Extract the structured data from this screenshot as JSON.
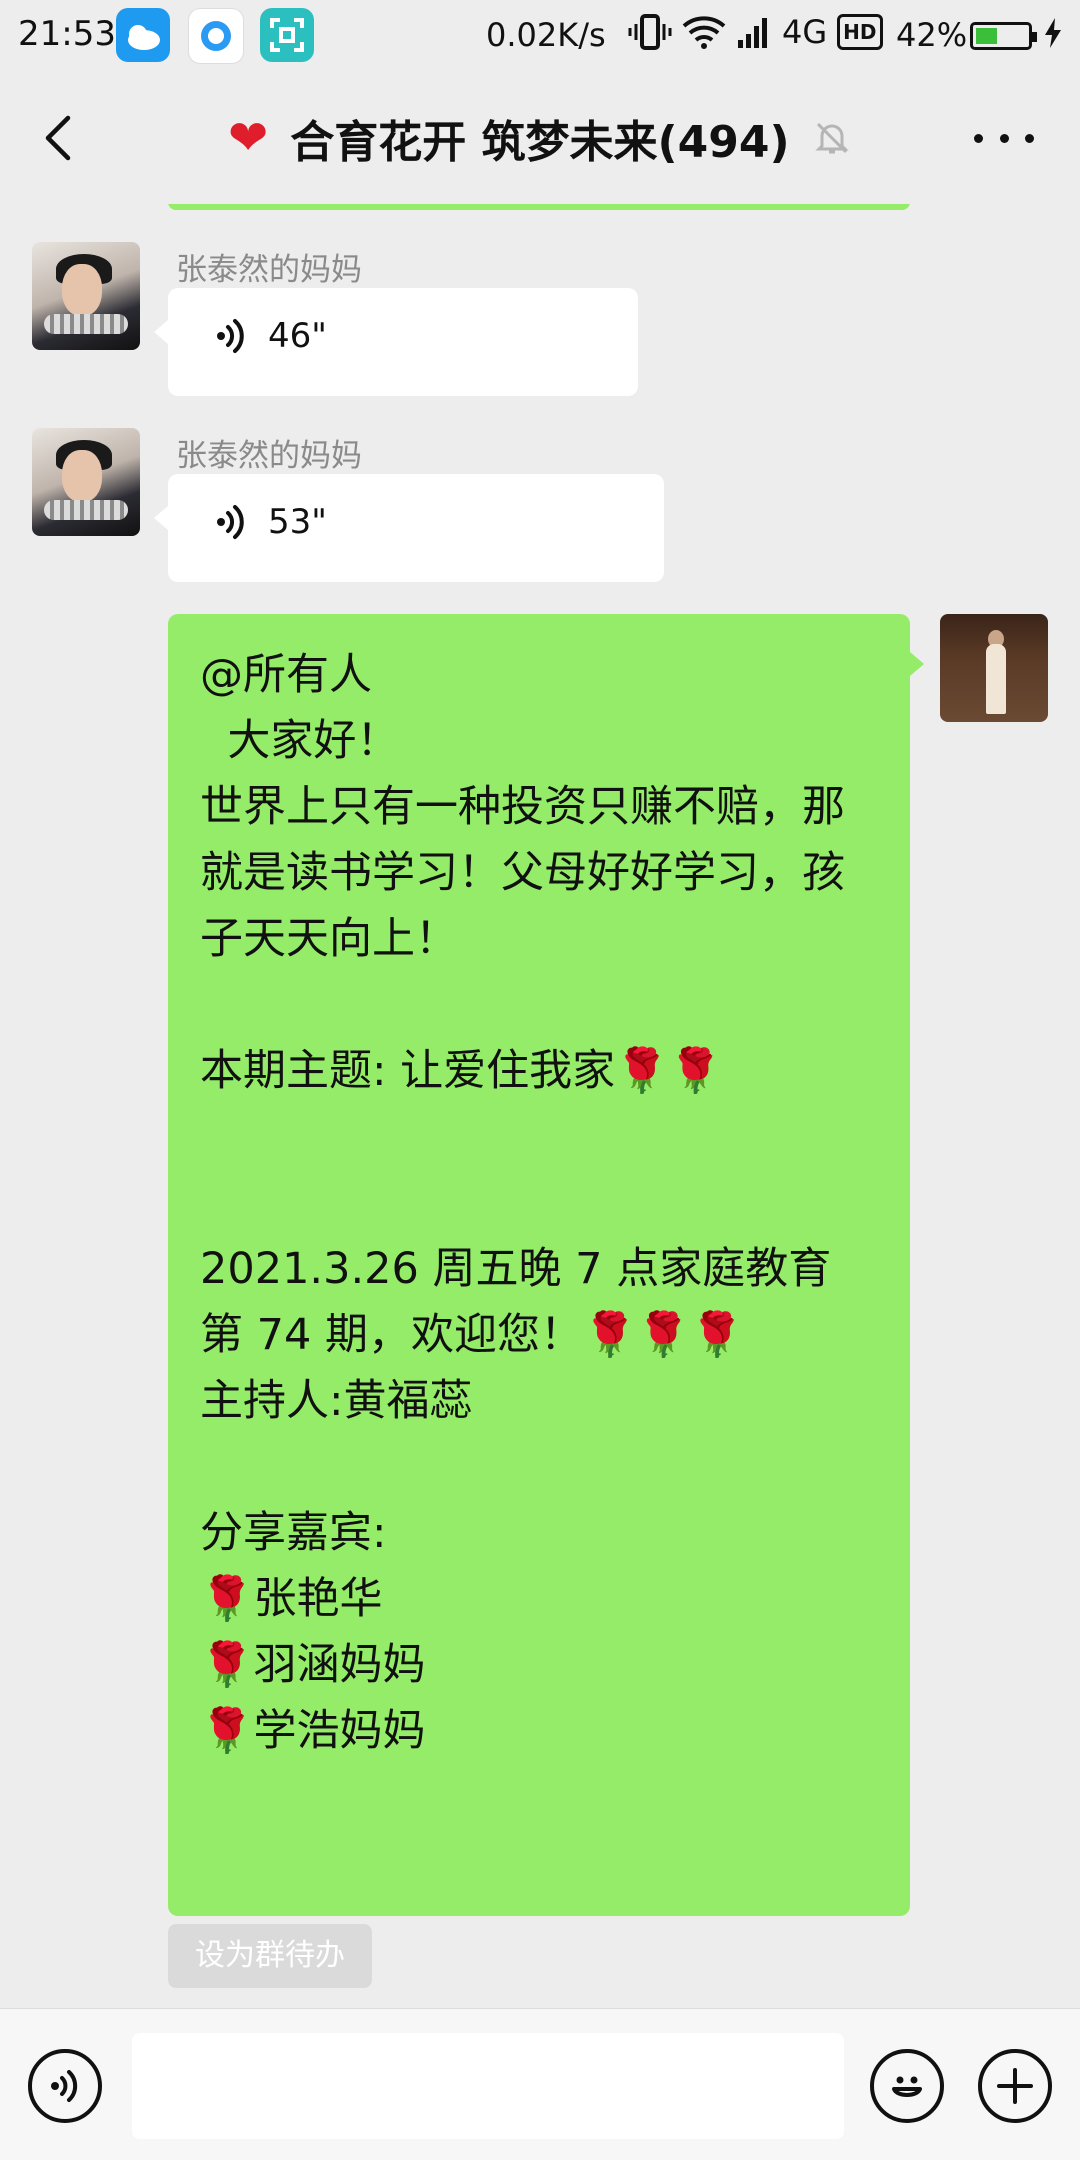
{
  "status_bar": {
    "time": "21:53",
    "net_speed": "0.02K/s",
    "network_type": "4G",
    "hd_badge": "HD",
    "battery_percent": "42%",
    "battery_level": 0.42
  },
  "nav": {
    "title": "合育花开 筑梦未来(494)",
    "heart": "❤",
    "colors": {
      "heart": "#e01e2b"
    }
  },
  "messages": [
    {
      "sender": "张泰然的妈妈",
      "type": "voice",
      "duration": "46\""
    },
    {
      "sender": "张泰然的妈妈",
      "type": "voice",
      "duration": "53\""
    },
    {
      "sender": "",
      "type": "text",
      "text": "@所有人\n  大家好！\n世界上只有一种投资只赚不赔，那就是读书学习！父母好好学习，孩子天天向上！\n\n本期主题: 让爱住我家🌹🌹\n\n\n2021.3.26 周五晚 7 点家庭教育第 74 期，欢迎您！🌹🌹🌹\n主持人:黄福蕊\n\n分享嘉宾:\n🌹张艳华\n🌹羽涵妈妈\n🌹学浩妈妈"
    }
  ],
  "todo_chip": "设为群待办",
  "colors": {
    "own_bubble": "#95ec69",
    "other_bubble": "#ffffff",
    "background": "#ededed"
  }
}
